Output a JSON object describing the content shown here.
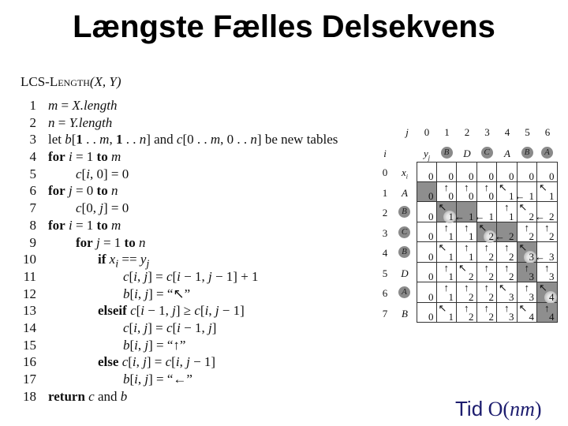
{
  "slide": {
    "title": "Længste Fælles Delsekvens",
    "footer_label": "Tid",
    "footer_complexity_prefix": "O(",
    "footer_complexity_var": "nm",
    "footer_complexity_suffix": ")",
    "footer_color": "#1c1c6e"
  },
  "algorithm": {
    "name": "LCS-Length",
    "params": "(X, Y)",
    "lines": [
      {
        "n": "1",
        "indent": 0,
        "html": "<i>m</i> = <i>X.length</i>"
      },
      {
        "n": "2",
        "indent": 0,
        "html": "<i>n</i> = <i>Y.length</i>"
      },
      {
        "n": "3",
        "indent": 0,
        "html": "let <i>b</i>[<b>1</b> . . <i>m</i>, <b>1</b> . . <i>n</i>] and <i>c</i>[0 . . <i>m</i>, 0 . . <i>n</i>] be new tables"
      },
      {
        "n": "4",
        "indent": 0,
        "html": "<b>for</b> <i>i</i> = 1 <b>to</b> <i>m</i>"
      },
      {
        "n": "5",
        "indent": 1,
        "html": "<i>c</i>[<i>i</i>, 0] = 0"
      },
      {
        "n": "6",
        "indent": 0,
        "html": "<b>for</b> <i>j</i> = 0 <b>to</b> <i>n</i>"
      },
      {
        "n": "7",
        "indent": 1,
        "html": "<i>c</i>[0, <i>j</i>] = 0"
      },
      {
        "n": "8",
        "indent": 0,
        "html": "<b>for</b> <i>i</i> = 1 <b>to</b> <i>m</i>"
      },
      {
        "n": "9",
        "indent": 1,
        "html": "<b>for</b> <i>j</i> = 1 <b>to</b> <i>n</i>"
      },
      {
        "n": "10",
        "indent": 2,
        "html": "<b>if</b> <i>x<sub>i</sub></i> == <i>y<sub>j</sub></i>"
      },
      {
        "n": "11",
        "indent": 3,
        "html": "<i>c</i>[<i>i</i>, <i>j</i>] = <i>c</i>[<i>i</i> − 1, <i>j</i> − 1] + 1"
      },
      {
        "n": "12",
        "indent": 3,
        "html": "<i>b</i>[<i>i</i>, <i>j</i>] = “↖”"
      },
      {
        "n": "13",
        "indent": 2,
        "html": "<b>elseif</b> <i>c</i>[<i>i</i> − 1, <i>j</i>] ≥ <i>c</i>[<i>i</i>, <i>j</i> − 1]"
      },
      {
        "n": "14",
        "indent": 3,
        "html": "<i>c</i>[<i>i</i>, <i>j</i>] = <i>c</i>[<i>i</i> − 1, <i>j</i>]"
      },
      {
        "n": "15",
        "indent": 3,
        "html": "<i>b</i>[<i>i</i>, <i>j</i>] = “↑”"
      },
      {
        "n": "16",
        "indent": 2,
        "html": "<b>else</b> <i>c</i>[<i>i</i>, <i>j</i>] = <i>c</i>[<i>i</i>, <i>j</i> − 1]"
      },
      {
        "n": "17",
        "indent": 3,
        "html": "<i>b</i>[<i>i</i>, <i>j</i>] = “←”"
      },
      {
        "n": "18",
        "indent": 0,
        "html": "<b>return</b> <i>c</i> and <i>b</i>"
      }
    ]
  },
  "lcs_table": {
    "j_label": "j",
    "i_label": "i",
    "y_label": "y",
    "y_sub": "j",
    "x_label": "x",
    "x_sub": "i",
    "j_values": [
      "0",
      "1",
      "2",
      "3",
      "4",
      "5",
      "6"
    ],
    "i_values": [
      "0",
      "1",
      "2",
      "3",
      "4",
      "5",
      "6",
      "7"
    ],
    "y": [
      "B",
      "D",
      "C",
      "A",
      "B",
      "A"
    ],
    "y_circled": [
      true,
      false,
      true,
      false,
      true,
      true
    ],
    "x": [
      "A",
      "B",
      "C",
      "B",
      "D",
      "A",
      "B"
    ],
    "x_circled": [
      false,
      true,
      true,
      true,
      false,
      true,
      false
    ],
    "values": [
      [
        0,
        0,
        0,
        0,
        0,
        0,
        0
      ],
      [
        0,
        0,
        0,
        0,
        1,
        1,
        1
      ],
      [
        0,
        1,
        1,
        1,
        1,
        2,
        2
      ],
      [
        0,
        1,
        1,
        2,
        2,
        2,
        2
      ],
      [
        0,
        1,
        1,
        2,
        2,
        3,
        3
      ],
      [
        0,
        1,
        2,
        2,
        2,
        3,
        3
      ],
      [
        0,
        1,
        2,
        2,
        3,
        3,
        4
      ],
      [
        0,
        1,
        2,
        2,
        3,
        4,
        4
      ]
    ],
    "arrows": [
      [
        "",
        "",
        "",
        "",
        "",
        "",
        ""
      ],
      [
        "",
        "up",
        "up",
        "up",
        "diag",
        "left",
        "diag"
      ],
      [
        "",
        "diag",
        "left",
        "left",
        "up",
        "diag",
        "left"
      ],
      [
        "",
        "up",
        "up",
        "diag",
        "left",
        "up",
        "up"
      ],
      [
        "",
        "diag",
        "up",
        "up",
        "up",
        "diag",
        "left"
      ],
      [
        "",
        "up",
        "diag",
        "up",
        "up",
        "up",
        "up"
      ],
      [
        "",
        "up",
        "up",
        "up",
        "diag",
        "up",
        "diag"
      ],
      [
        "",
        "diag",
        "up",
        "up",
        "up",
        "diag",
        "up"
      ]
    ],
    "path_shaded": [
      [
        1,
        0
      ],
      [
        2,
        1
      ],
      [
        2,
        2
      ],
      [
        3,
        3
      ],
      [
        3,
        4
      ],
      [
        4,
        5
      ],
      [
        5,
        5
      ],
      [
        6,
        6
      ],
      [
        7,
        6
      ]
    ],
    "path_matches": [
      [
        2,
        1
      ],
      [
        3,
        3
      ],
      [
        4,
        5
      ],
      [
        6,
        6
      ]
    ],
    "shade_color": "#8e8e8e"
  }
}
